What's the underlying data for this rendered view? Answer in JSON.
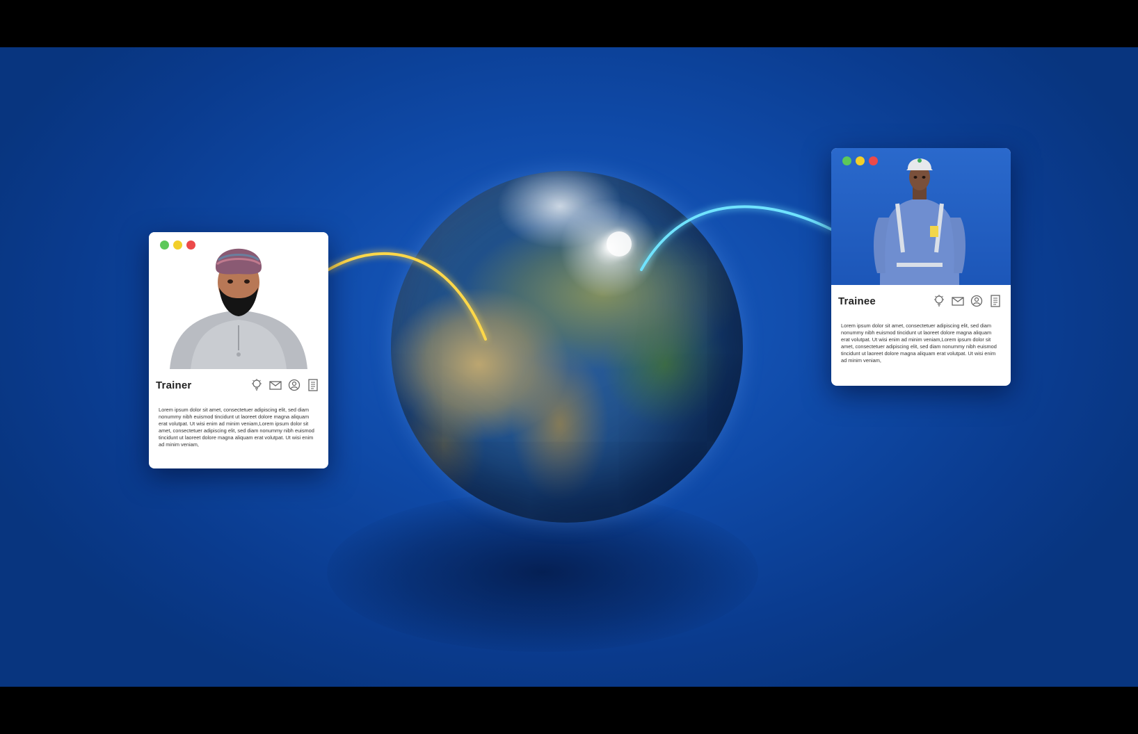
{
  "scene": {
    "colors": {
      "background": "#0f4aa8",
      "trainer_link": "#ffd84a",
      "trainee_link": "#6fe3ff"
    }
  },
  "trainer_card": {
    "title": "Trainer",
    "window_controls": [
      "green-dot",
      "yellow-dot",
      "red-dot"
    ],
    "icons": [
      "lightbulb-icon",
      "mail-icon",
      "user-icon",
      "document-icon"
    ],
    "body": "Lorem ipsum dolor sit amet, consectetuer adipiscing elit, sed diam nonummy nibh euismod tincidunt ut laoreet dolore magna aliquam erat volutpat. Ut wisi enim ad minim veniam,Lorem ipsum dolor sit amet, consectetuer adipiscing elit, sed diam nonummy nibh euismod tincidunt ut laoreet dolore magna aliquam erat volutpat. Ut wisi enim ad minim veniam,"
  },
  "trainee_card": {
    "title": "Trainee",
    "window_controls": [
      "green-dot",
      "yellow-dot",
      "red-dot"
    ],
    "icons": [
      "lightbulb-icon",
      "mail-icon",
      "user-icon",
      "document-icon"
    ],
    "body": "Lorem ipsum dolor sit amet, consectetuer adipiscing elit, sed diam nonummy nibh euismod tincidunt ut laoreet dolore magna aliquam erat volutpat. Ut wisi enim ad minim veniam,Lorem ipsum dolor sit amet, consectetuer adipiscing elit, sed diam nonummy nibh euismod tincidunt ut laoreet dolore magna aliquam erat volutpat. Ut wisi enim ad minim veniam,"
  }
}
